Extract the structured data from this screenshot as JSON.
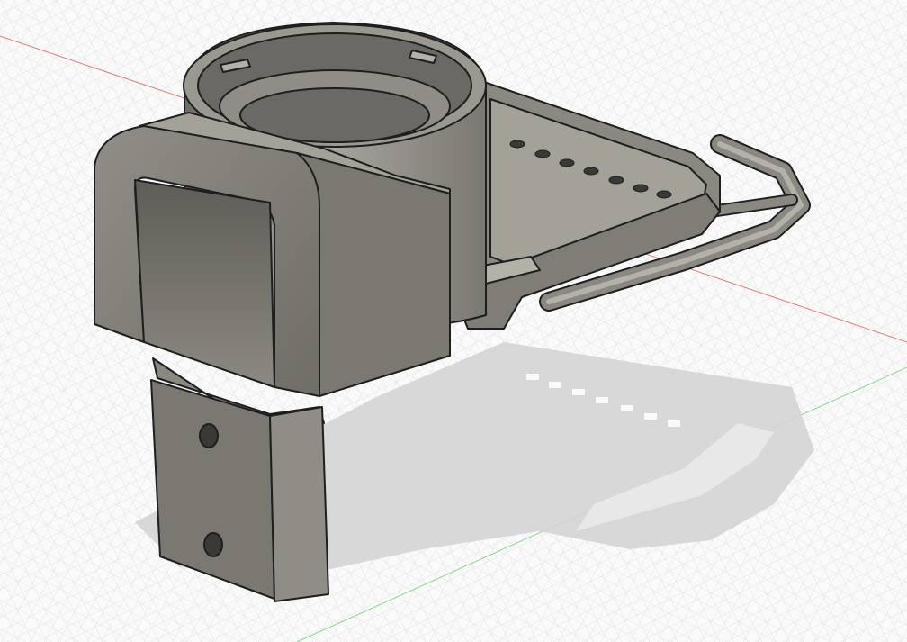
{
  "app": {
    "name": ""
  },
  "viewport": {
    "background": "#fafafa",
    "grid_minor_color": "#e3e3e3",
    "grid_major_color": "#c9c9c9",
    "x_axis_color": "#e07b7b",
    "y_axis_color": "#8fd68f",
    "shadow_color": "#d4d4d4",
    "model_base_color": "#8a8880",
    "model_light_color": "#a3a198",
    "model_dark_color": "#55544f",
    "model_edge_color": "#1e1e1e"
  },
  "scene": {
    "bodies": [
      "housing-body",
      "tray-body",
      "handle-loop",
      "mount-plate"
    ]
  }
}
